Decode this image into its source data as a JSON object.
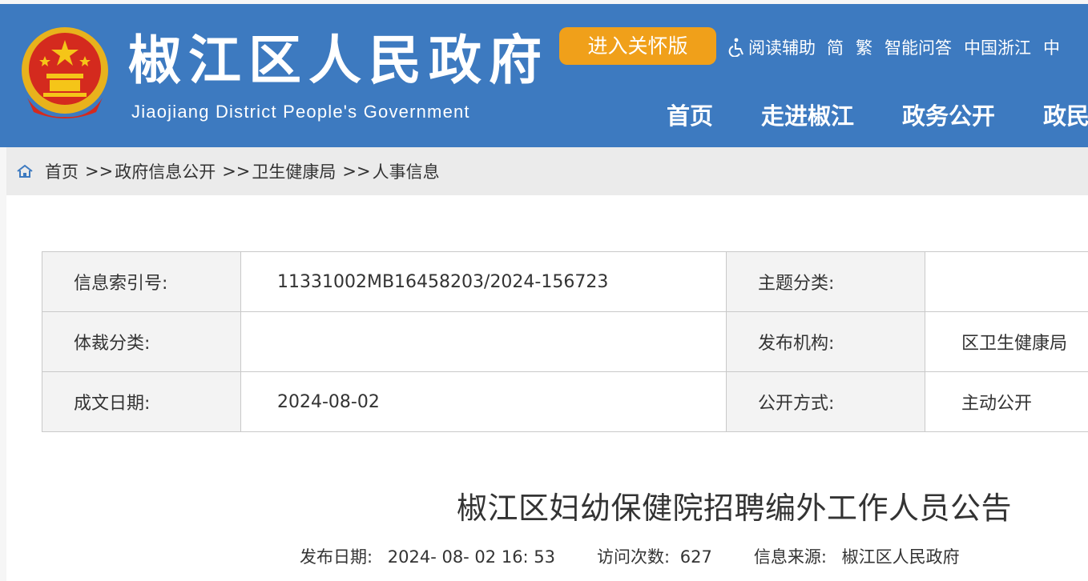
{
  "header": {
    "site_title": "椒江区人民政府",
    "site_subtitle": "Jiaojiang District People's Government",
    "care_button": "进入关怀版",
    "top_links": [
      "阅读辅助",
      "简",
      "繁",
      "智能问答",
      "中国浙江",
      "中"
    ],
    "nav": [
      "首页",
      "走进椒江",
      "政务公开",
      "政民"
    ],
    "colors": {
      "header_bg": "#3d7ac0",
      "care_button_bg": "#f0a01a"
    }
  },
  "breadcrumb": {
    "icon": "home-icon",
    "items": [
      "首页",
      "政府信息公开",
      "卫生健康局",
      "人事信息"
    ],
    "separator": ">>"
  },
  "meta": {
    "rows": [
      {
        "label1": "信息索引号:",
        "value1": "11331002MB16458203/2024-156723",
        "label2": "主题分类:",
        "value2": ""
      },
      {
        "label1": "体裁分类:",
        "value1": "",
        "label2": "发布机构:",
        "value2": "区卫生健康局"
      },
      {
        "label1": "成文日期:",
        "value1": "2024-08-02",
        "label2": "公开方式:",
        "value2": "主动公开"
      }
    ]
  },
  "article": {
    "title": "椒江区妇幼保健院招聘编外工作人员公告",
    "publish_label": "发布日期:",
    "publish_date": "2024- 08- 02 16: 53",
    "visits_label": "访问次数:",
    "visits": "627",
    "source_label": "信息来源:",
    "source": "椒江区人民政府"
  }
}
